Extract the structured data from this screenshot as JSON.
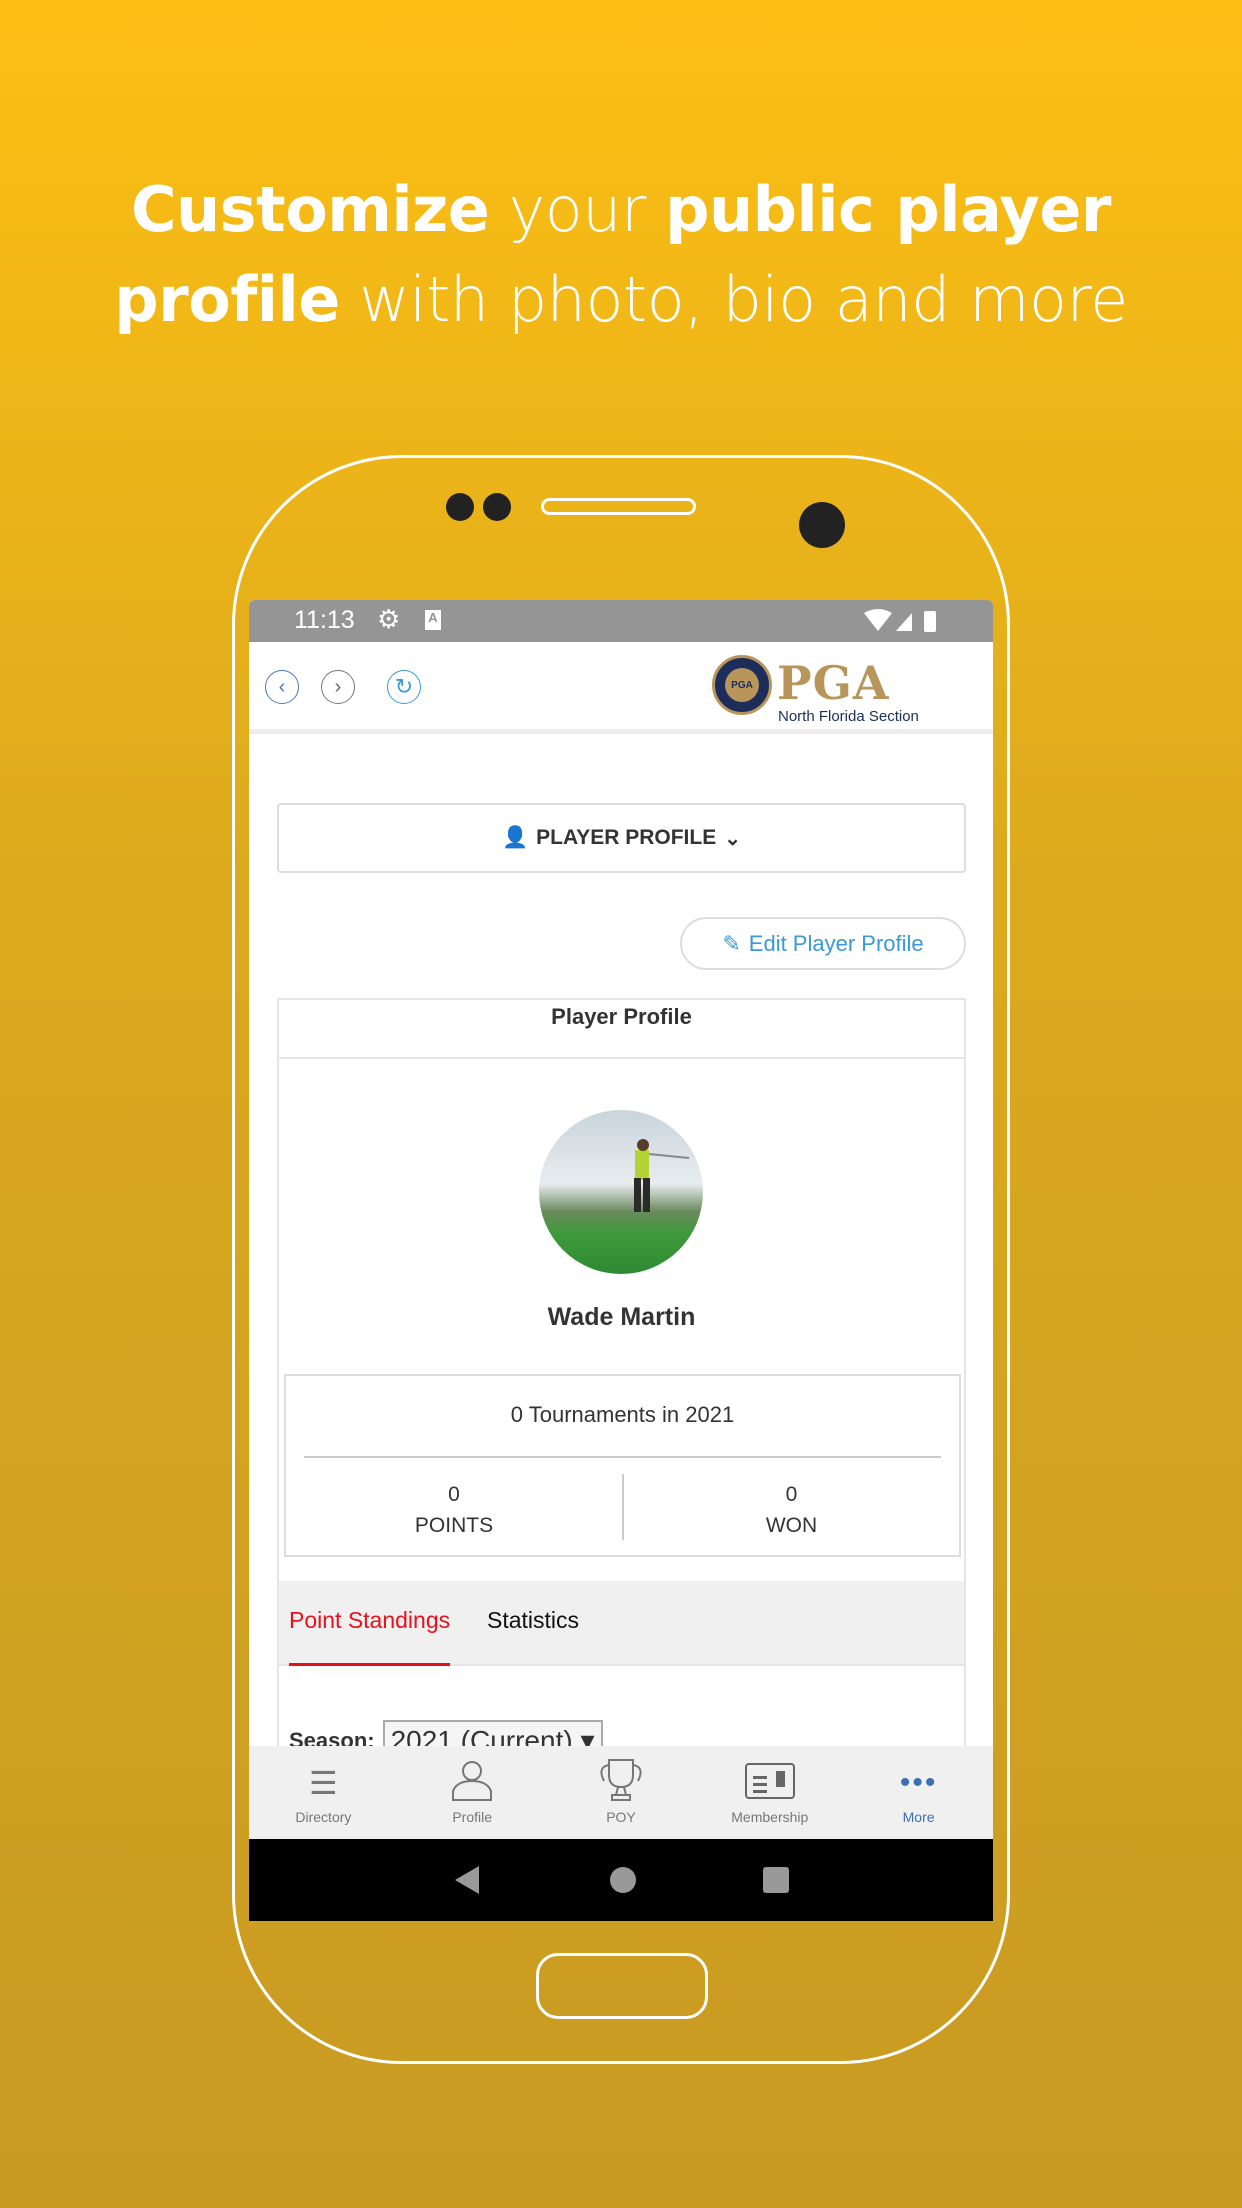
{
  "headline": {
    "line1_bold1": "Customize",
    "line1_light": " your ",
    "line1_bold2": "public player",
    "line2_bold": "profile",
    "line2_light": " with photo, bio and more"
  },
  "status_bar": {
    "time": "11:13",
    "icons": [
      "gear-icon",
      "font-a-icon",
      "wifi-icon",
      "signal-icon",
      "battery-icon"
    ]
  },
  "header": {
    "logo_text": "PGA",
    "logo_subtitle": "North Florida Section",
    "nav_icons": [
      "back-icon",
      "forward-icon",
      "refresh-icon"
    ]
  },
  "profile_dropdown": {
    "label": "PLAYER PROFILE"
  },
  "edit_button": {
    "label": "Edit Player Profile"
  },
  "card": {
    "title": "Player Profile",
    "player_name": "Wade Martin",
    "stats": {
      "summary": "0 Tournaments in 2021",
      "points_value": "0",
      "points_label": "POINTS",
      "won_value": "0",
      "won_label": "WON"
    }
  },
  "tabs": [
    {
      "label": "Point Standings",
      "active": true
    },
    {
      "label": "Statistics",
      "active": false
    }
  ],
  "season": {
    "label": "Season:",
    "value": "2021 (Current)"
  },
  "bottom_nav": [
    {
      "label": "Directory"
    },
    {
      "label": "Profile"
    },
    {
      "label": "POY"
    },
    {
      "label": "Membership"
    },
    {
      "label": "More",
      "active": true
    }
  ],
  "colors": {
    "accent_red": "#e8101a",
    "link_blue": "#3a9ad4",
    "more_blue": "#3e6fb0",
    "pga_gold": "#b8955a",
    "background_top": "#fdbf13",
    "background_bottom": "#c89a22"
  }
}
